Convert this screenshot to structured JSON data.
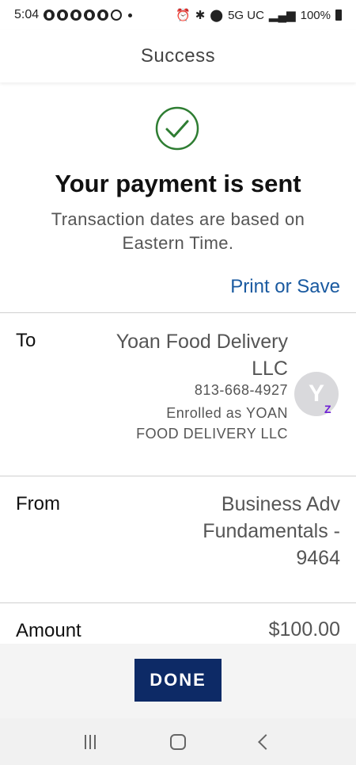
{
  "status_bar": {
    "time": "5:04",
    "network": "5G UC",
    "battery": "100%"
  },
  "header": {
    "title": "Success"
  },
  "confirmation": {
    "headline": "Your payment is sent",
    "subtext": "Transaction dates are based on Eastern Time.",
    "print_link": "Print or Save",
    "check_color": "#2e7d32"
  },
  "details": {
    "to": {
      "label": "To",
      "name": "Yoan Food Delivery LLC",
      "phone": "813-668-4927",
      "enrolled": "Enrolled as YOAN FOOD DELIVERY LLC",
      "avatar_initial": "Y",
      "badge": "Z"
    },
    "from": {
      "label": "From",
      "account": "Business Adv Fundamentals - 9464"
    },
    "amount": {
      "label": "Amount",
      "value": "$100.00"
    }
  },
  "footer": {
    "done_label": "DONE",
    "done_color": "#0d2a66"
  },
  "nav_bar": {
    "icons": [
      "recent-apps-icon",
      "home-icon",
      "back-icon"
    ]
  }
}
